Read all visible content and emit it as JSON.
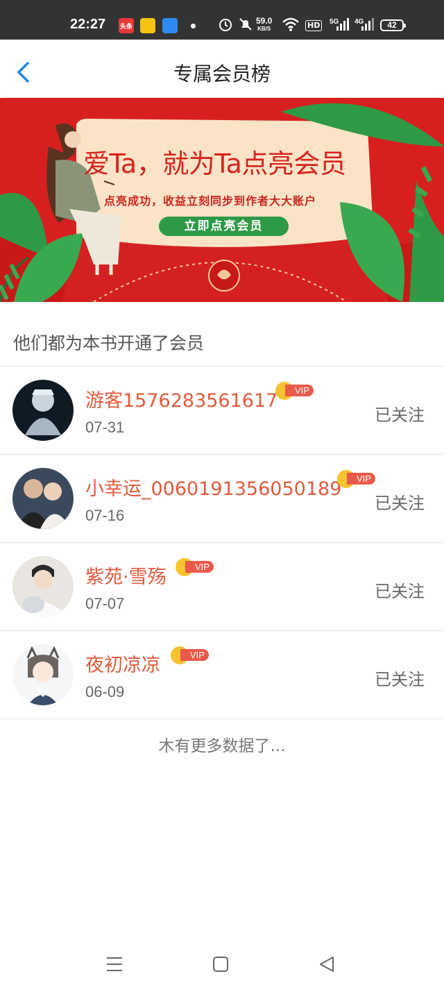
{
  "status_bar": {
    "time": "22:27",
    "app_badge_1": "头条",
    "speed_value": "59.0",
    "speed_unit": "KB/S",
    "hd": "HD",
    "net_5g": "5G",
    "net_4g": "4G",
    "battery": "42"
  },
  "header": {
    "title": "专属会员榜"
  },
  "banner": {
    "headline": "爱Ta，就为Ta点亮会员",
    "subline": "点亮成功，收益立刻同步到作者大大账户",
    "cta": "立即点亮会员",
    "colors": {
      "background": "#d81f1f",
      "card": "#fbe3c8",
      "cta": "#2e9a47",
      "leaf": "#2f9a45"
    }
  },
  "section": {
    "title": "他们都为本书开通了会员"
  },
  "members": [
    {
      "name": "游客1576283561617",
      "vip": "VIP",
      "date": "07-31",
      "follow": "已关注"
    },
    {
      "name": "小幸运_0060191356050189",
      "vip": "VIP",
      "date": "07-16",
      "follow": "已关注"
    },
    {
      "name": "紫苑·雪殇",
      "vip": "VIP",
      "date": "07-07",
      "follow": "已关注"
    },
    {
      "name": "夜初凉凉",
      "vip": "VIP",
      "date": "06-09",
      "follow": "已关注"
    }
  ],
  "footer": {
    "no_more": "木有更多数据了..."
  },
  "theme": {
    "accent": "#1e88e5",
    "name_color": "#e05a3c",
    "vip_color": "#ea5a4a",
    "crown_color": "#f5c330"
  }
}
